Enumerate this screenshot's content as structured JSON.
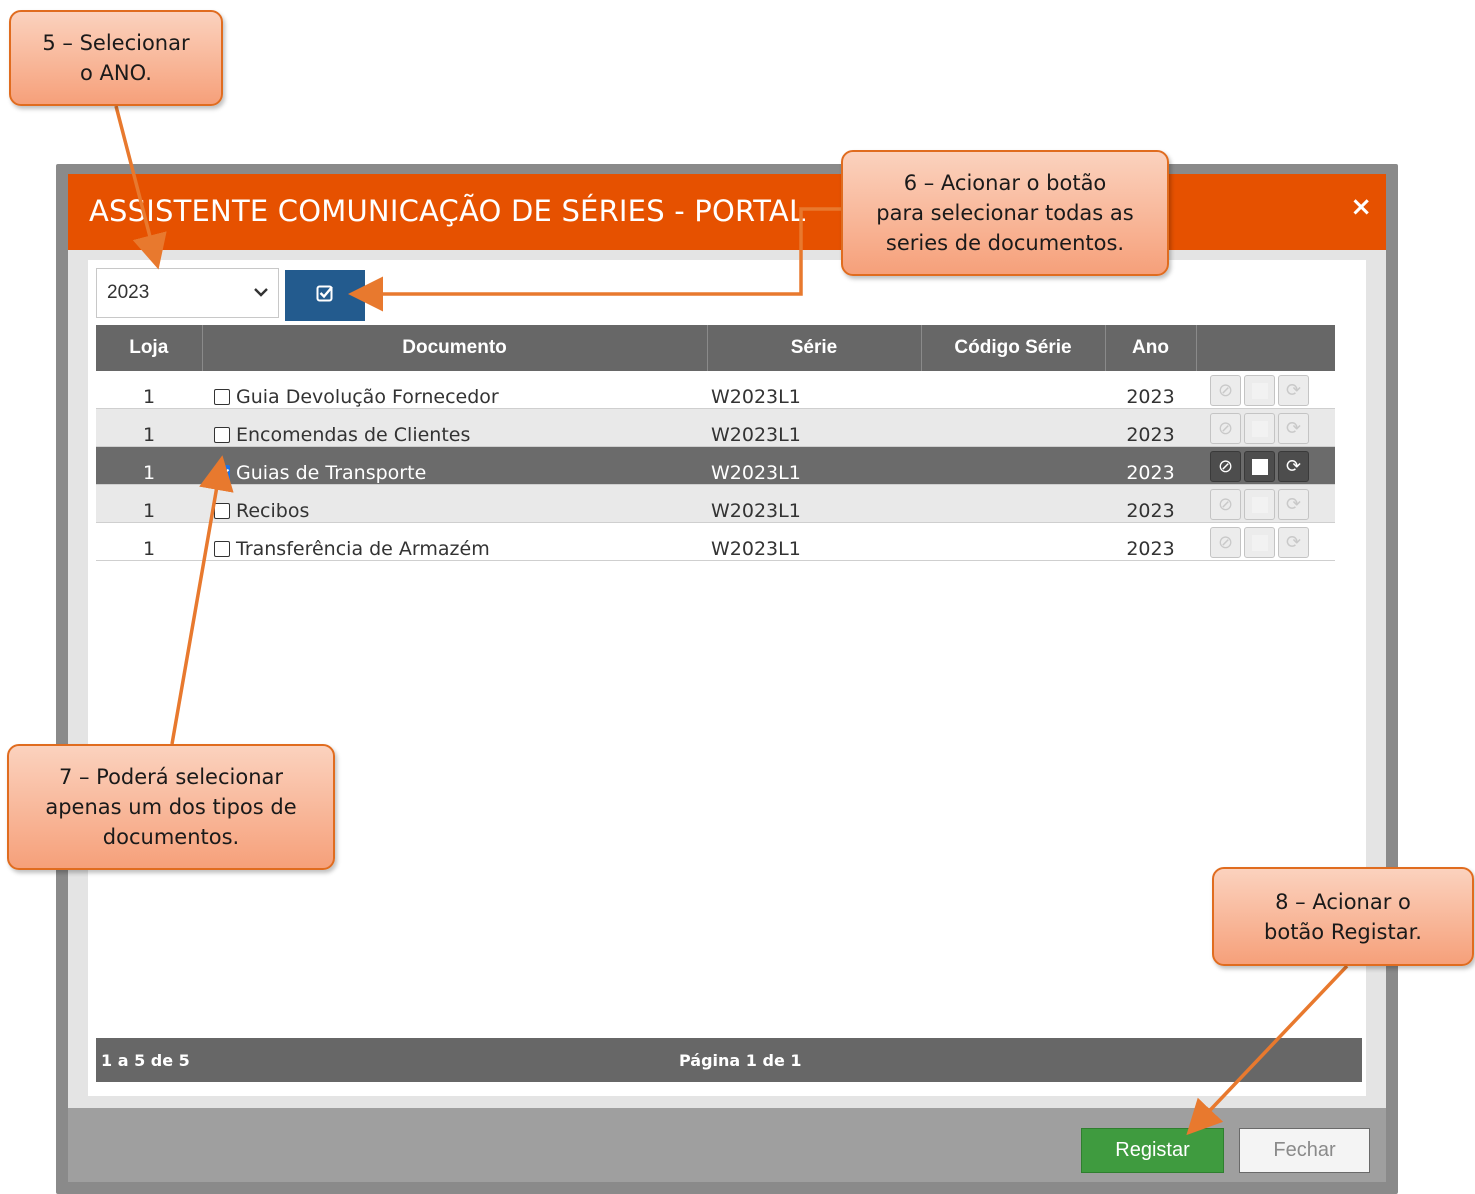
{
  "modal": {
    "title": "ASSISTENTE COMUNICAÇÃO DE SÉRIES - PORTAL",
    "close_icon": "×"
  },
  "toolbar": {
    "year_value": "2023",
    "select_chevron": "⌄",
    "select_all_icon": "🗹"
  },
  "table": {
    "headers": [
      "Loja",
      "Documento",
      "Série",
      "Código Série",
      "Ano",
      ""
    ],
    "rows": [
      {
        "loja": "1",
        "documento": "Guia Devolução Fornecedor",
        "serie": "W2023L1",
        "codigo_serie": "",
        "ano": "2023",
        "checked": false
      },
      {
        "loja": "1",
        "documento": "Encomendas de Clientes",
        "serie": "W2023L1",
        "codigo_serie": "",
        "ano": "2023",
        "checked": false
      },
      {
        "loja": "1",
        "documento": "Guias de Transporte",
        "serie": "W2023L1",
        "codigo_serie": "",
        "ano": "2023",
        "checked": true
      },
      {
        "loja": "1",
        "documento": "Recibos",
        "serie": "W2023L1",
        "codigo_serie": "",
        "ano": "2023",
        "checked": false
      },
      {
        "loja": "1",
        "documento": "Transferência de Armazém",
        "serie": "W2023L1",
        "codigo_serie": "",
        "ano": "2023",
        "checked": false
      }
    ],
    "action_icons": {
      "cancel": "⊘",
      "refresh": "⟳"
    }
  },
  "pager": {
    "count": "1 a 5 de 5",
    "page": "Página 1 de 1"
  },
  "footer": {
    "register_label": "Registar",
    "close_label": "Fechar"
  },
  "callouts": {
    "c5": [
      "5 – Selecionar",
      "o ANO."
    ],
    "c6": [
      "6 – Acionar o botão",
      "para selecionar todas as",
      "series de documentos."
    ],
    "c7": [
      "7 – Poderá selecionar",
      "apenas um dos tipos de",
      "documentos."
    ],
    "c8": [
      "8 – Acionar o",
      "botão Registar."
    ]
  },
  "colors": {
    "header": "#e65100",
    "select_all": "#235b8e",
    "register": "#3f9b3f",
    "callout_border": "#e06c1f"
  }
}
